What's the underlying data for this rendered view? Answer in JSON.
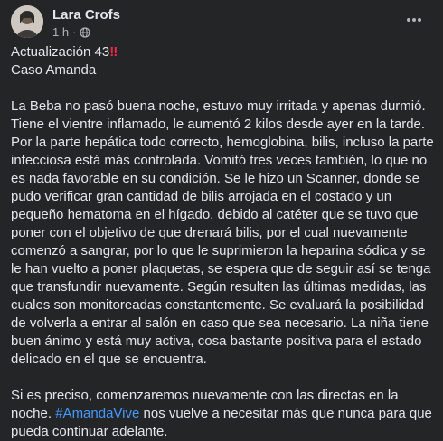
{
  "post": {
    "author": "Lara Crofs",
    "time": "1 h",
    "separator": "·",
    "privacy_icon": "globe-icon",
    "more_icon": "more-horizontal-icon",
    "title_line": "Actualización 43",
    "title_emoji": "‼",
    "subtitle": "Caso Amanda",
    "body_paragraph_1": "La Beba no pasó buena noche, estuvo muy irritada y apenas durmió. Tiene el vientre inflamado, le aumentó 2 kilos desde ayer en la tarde. Por la parte hepática todo correcto, hemoglobina, bilis, incluso la parte infecciosa está más controlada. Vomitó tres veces también, lo que no es nada favorable en su condición. Se le hizo un Scanner, donde se pudo verificar gran cantidad de bilis arrojada en el costado y un pequeño hematoma en el hígado, debido al catéter que se tuvo que poner con el objetivo de que drenará bilis, por el cual nuevamente comenzó a sangrar, por lo que le suprimieron la heparina sódica y se le han vuelto a poner plaquetas, se espera que de seguir así se tenga que transfundir nuevamente. Según resulten las últimas medidas, las cuales son monitoreadas constantemente. Se evaluará la posibilidad de volverla a entrar al salón en caso que sea necesario. La niña tiene buen ánimo y está muy activa, cosa bastante positiva para el estado delicado en el que se encuentra.",
    "body_paragraph_2_start": "Si es preciso, comenzaremos nuevamente con las directas en la noche.",
    "hashtag": "#AmandaVive",
    "body_paragraph_2_end": "nos vuelve a necesitar más que nunca para que pueda continuar adelante."
  },
  "colors": {
    "background": "#242526",
    "text": "#e4e6eb",
    "secondary_text": "#b0b3b8",
    "hashtag": "#4599ff",
    "emoji_red": "#f02849"
  }
}
